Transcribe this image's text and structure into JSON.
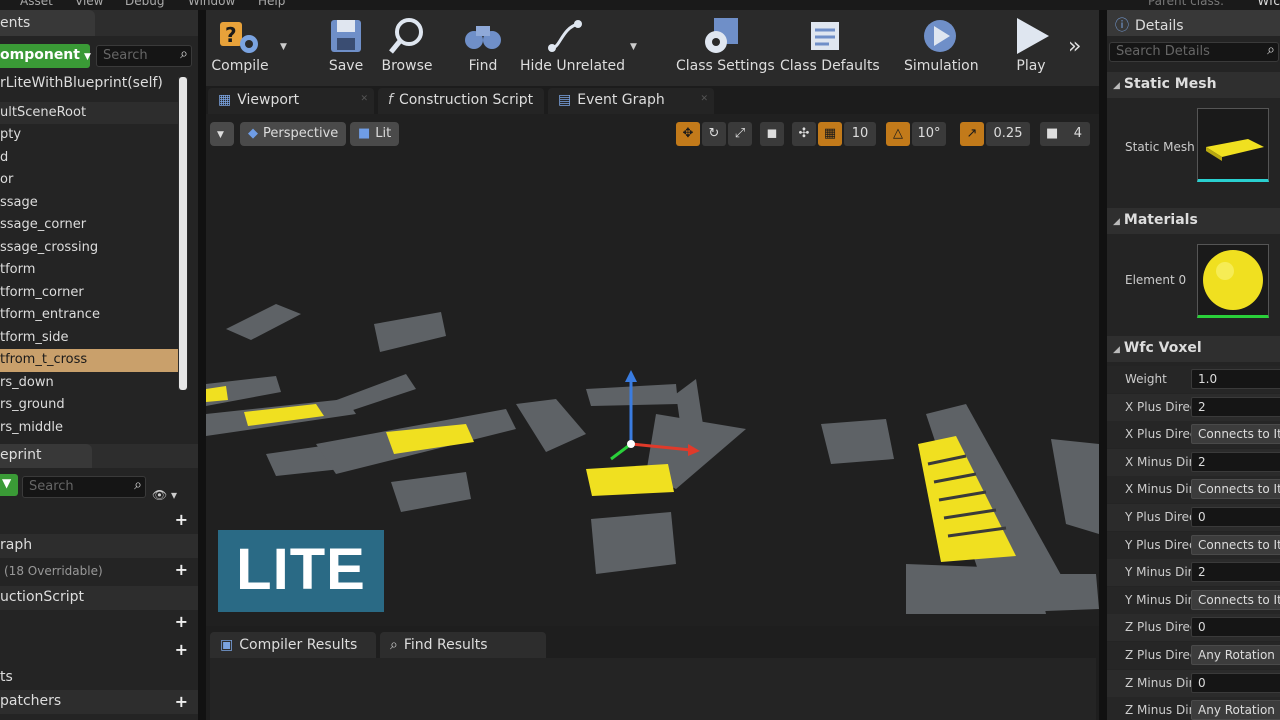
{
  "menubar": {
    "items": [
      "Asset",
      "View",
      "Debug",
      "Window",
      "Help"
    ],
    "parent_label": "Parent class:",
    "parent_value": "Wfc"
  },
  "components": {
    "tab_label": "ents",
    "add_label": "omponent",
    "search_placeholder": "Search",
    "self_item": "rLiteWithBlueprint(self)",
    "root_item": "ultSceneRoot",
    "items": [
      "pty",
      "d",
      "or",
      "ssage",
      "ssage_corner",
      "ssage_crossing",
      "tform",
      "tform_corner",
      "tform_entrance",
      "tform_side",
      "tfrom_t_cross",
      "rs_down",
      "rs_ground",
      "rs_middle"
    ]
  },
  "my_blueprint": {
    "tab_label": "eprint",
    "search_placeholder": "Search",
    "graph_label": "raph",
    "overridable": "(18 Overridable)",
    "construction": "uctionScript",
    "section_s": "ts",
    "dispatchers": "patchers"
  },
  "toolbar": {
    "compile": "Compile",
    "save": "Save",
    "browse": "Browse",
    "find": "Find",
    "hide_unrelated": "Hide Unrelated",
    "class_settings": "Class Settings",
    "class_defaults": "Class Defaults",
    "simulation": "Simulation",
    "play": "Play"
  },
  "doc_tabs": {
    "viewport": "Viewport",
    "construction": "Construction Script",
    "event_graph": "Event Graph"
  },
  "viewport": {
    "perspective": "Perspective",
    "lit": "Lit",
    "grid_snap": "10",
    "rot_snap": "10°",
    "scale_snap": "0.25",
    "cam_speed": "4",
    "overlay": "LITE"
  },
  "bottom_tabs": {
    "compiler": "Compiler Results",
    "find": "Find Results"
  },
  "details": {
    "title": "Details",
    "search_placeholder": "Search Details",
    "static_mesh_cat": "Static Mesh",
    "static_mesh_lbl": "Static Mesh",
    "materials_cat": "Materials",
    "element0": "Element 0",
    "wfc_cat": "Wfc Voxel",
    "props": [
      {
        "label": "Weight",
        "value": "1.0",
        "dd": false
      },
      {
        "label": "X Plus Direc",
        "value": "2",
        "dd": false
      },
      {
        "label": "X Plus Direc",
        "value": "Connects to Itsel",
        "dd": true
      },
      {
        "label": "X Minus Dir",
        "value": "2",
        "dd": false
      },
      {
        "label": "X Minus Dir",
        "value": "Connects to Itsel",
        "dd": true
      },
      {
        "label": "Y Plus Direc",
        "value": "0",
        "dd": false
      },
      {
        "label": "Y Plus Direc",
        "value": "Connects to Itsel",
        "dd": true
      },
      {
        "label": "Y Minus Dir",
        "value": "2",
        "dd": false
      },
      {
        "label": "Y Minus Dir",
        "value": "Connects to Itsel",
        "dd": true
      },
      {
        "label": "Z Plus Direc",
        "value": "0",
        "dd": false
      },
      {
        "label": "Z Plus Direc",
        "value": "Any Rotation",
        "dd": true
      },
      {
        "label": "Z Minus Dir",
        "value": "0",
        "dd": false
      },
      {
        "label": "Z Minus Dir",
        "value": "Any Rotation",
        "dd": true
      }
    ]
  },
  "colors": {
    "accent_green": "#3a9a36",
    "selection": "#c9a06b",
    "snap_orange": "#c27a1a",
    "mesh_yellow": "#f0e020"
  }
}
